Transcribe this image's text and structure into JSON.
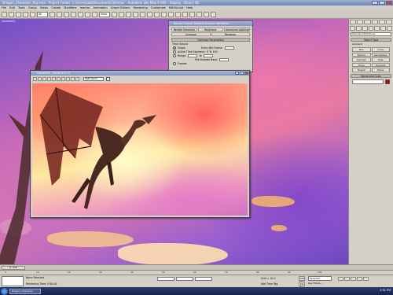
{
  "window": {
    "title": "Dragon_Character_Rig.max  -  Project Folder: C:\\Users\\Lab\\Documents\\3dsmax  -  Autodesk 3ds Max 9 SP2  -  Display : Direct 3D"
  },
  "menu": [
    "File",
    "Edit",
    "Tools",
    "Group",
    "Views",
    "Create",
    "Modifiers",
    "reactor",
    "Animation",
    "Graph Editors",
    "Rendering",
    "Customize",
    "MAXScript",
    "Help"
  ],
  "toolbar": {
    "selection_filter": "All",
    "view_select": "View"
  },
  "viewport": {
    "label": "Camera01"
  },
  "render_setup": {
    "title": "Render Scene: Default Scanline Renderer",
    "tabs": [
      "Render Elements",
      "Raytracer",
      "Advanced Lighting",
      "Common",
      "Renderer"
    ],
    "section": "Common Parameters",
    "group_label": "Time Output",
    "rows": [
      "Single",
      "Active Time Segment:",
      "Range:",
      "Frames"
    ],
    "range_to": "To",
    "every_nth": "Every Nth Frame:",
    "range_field": "0 To 100",
    "file_number_base": "File Number Base:"
  },
  "frame_window": {
    "title": "Camera01, frame 0 (1:1)",
    "channel": "RGB Alpha"
  },
  "command_panel": {
    "category": "Standard Primitives",
    "rollout_object_type": "Object Type",
    "autogrid": "AutoGrid",
    "buttons": [
      "Box",
      "Cone",
      "Sphere",
      "GeoSphere",
      "Cylinder",
      "Tube",
      "Torus",
      "Pyramid",
      "Teapot",
      "Plane"
    ],
    "rollout_name_color": "Name and Color",
    "color": "#b01010"
  },
  "timeline": {
    "slider": "0 / 100"
  },
  "ruler": [
    "0",
    "10",
    "20",
    "30",
    "40",
    "50",
    "60",
    "70",
    "80",
    "90",
    "100"
  ],
  "status": {
    "selection": "None Selected",
    "prompt": "Rendering Time: 0:00:04",
    "grid": "Grid = 10.0",
    "add_time_tag": "Add Time Tag",
    "auto_key": "Auto Key",
    "set_key": "Set Key",
    "selected": "Selected",
    "key_filters": "Key Filters..."
  },
  "taskbar": {
    "task": "Dragon_Characte...",
    "clock": "4:51 PM"
  }
}
